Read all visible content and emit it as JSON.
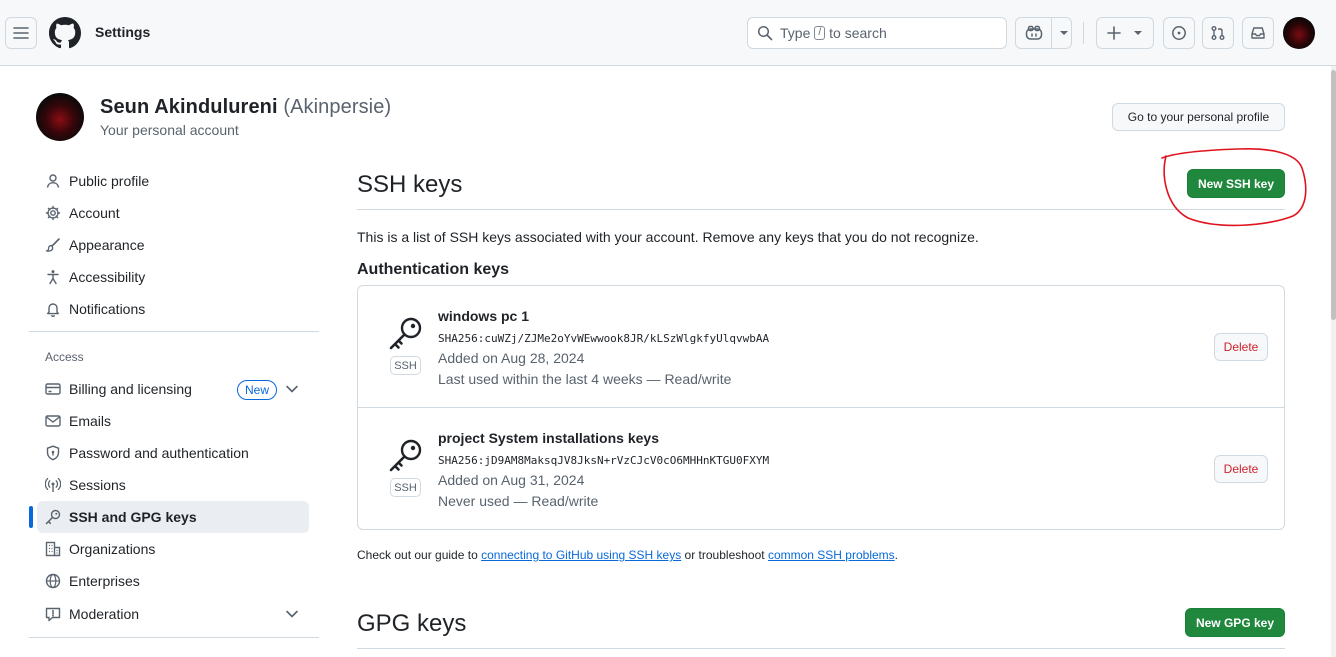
{
  "header": {
    "context_title": "Settings",
    "search": {
      "prefix": "Type",
      "key": "/",
      "suffix": "to search"
    }
  },
  "profile": {
    "name": "Seun Akindulureni",
    "login": "(Akinpersie)",
    "subtitle": "Your personal account",
    "go_profile_label": "Go to your personal profile"
  },
  "sidebar": {
    "items": [
      {
        "label": "Public profile",
        "icon": "person-icon"
      },
      {
        "label": "Account",
        "icon": "gear-icon"
      },
      {
        "label": "Appearance",
        "icon": "paintbrush-icon"
      },
      {
        "label": "Accessibility",
        "icon": "accessibility-icon"
      },
      {
        "label": "Notifications",
        "icon": "bell-icon"
      }
    ],
    "access_heading": "Access",
    "access_items": [
      {
        "label": "Billing and licensing",
        "icon": "credit-card-icon",
        "badge": "New"
      },
      {
        "label": "Emails",
        "icon": "mail-icon"
      },
      {
        "label": "Password and authentication",
        "icon": "shield-lock-icon"
      },
      {
        "label": "Sessions",
        "icon": "broadcast-icon"
      },
      {
        "label": "SSH and GPG keys",
        "icon": "key-icon",
        "active": true
      },
      {
        "label": "Organizations",
        "icon": "organization-icon"
      },
      {
        "label": "Enterprises",
        "icon": "globe-icon"
      },
      {
        "label": "Moderation",
        "icon": "report-icon"
      }
    ]
  },
  "main": {
    "ssh_title": "SSH keys",
    "new_ssh_label": "New SSH key",
    "intro": "This is a list of SSH keys associated with your account. Remove any keys that you do not recognize.",
    "auth_heading": "Authentication keys",
    "keys": [
      {
        "title": "windows pc 1",
        "fingerprint": "SHA256:cuWZj/ZJMe2oYvWEwwook8JR/kLSzWlgkfyUlqvwbAA",
        "added": "Added on Aug 28, 2024",
        "usage": "Last used within the last 4 weeks — Read/write",
        "type_label": "SSH",
        "delete_label": "Delete"
      },
      {
        "title": "project System installations keys",
        "fingerprint": "SHA256:jD9AM8MaksqJV8JksN+rVzCJcV0cO6MHHnKTGU0FXYM",
        "added": "Added on Aug 31, 2024",
        "usage": "Never used — Read/write",
        "type_label": "SSH",
        "delete_label": "Delete"
      }
    ],
    "footnote": {
      "pre": "Check out our guide to",
      "link1": "connecting to GitHub using SSH keys",
      "mid": "or troubleshoot",
      "link2": "common SSH problems",
      "post": "."
    },
    "gpg_title": "GPG keys",
    "new_gpg_label": "New GPG key"
  },
  "colors": {
    "accent": "#0969da",
    "primary_button": "#1f883d",
    "danger": "#cf222e",
    "annotation": "#e0141e"
  }
}
